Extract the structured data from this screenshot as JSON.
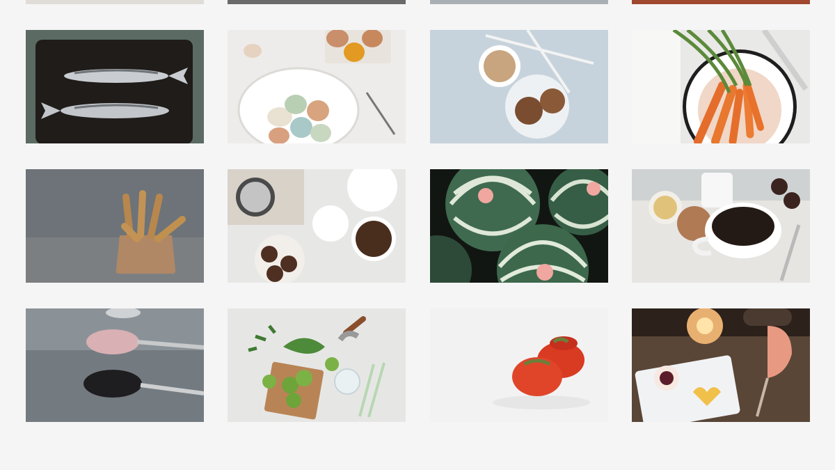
{
  "gallery": {
    "top_row": [
      {
        "subject": "partial-photo-1"
      },
      {
        "subject": "partial-photo-2"
      },
      {
        "subject": "partial-photo-3"
      },
      {
        "subject": "partial-photo-4"
      }
    ],
    "photos": [
      {
        "subject": "mackerel-on-baking-tray"
      },
      {
        "subject": "eggs-in-white-bowl"
      },
      {
        "subject": "coffee-and-cookies"
      },
      {
        "subject": "carrots-on-plate"
      },
      {
        "subject": "breadsticks-in-paper-bag"
      },
      {
        "subject": "coffee-beans-and-french-press"
      },
      {
        "subject": "kabocha-squash"
      },
      {
        "subject": "cup-of-coffee"
      },
      {
        "subject": "spoons-with-salt-and-seeds"
      },
      {
        "subject": "limes-and-herbs"
      },
      {
        "subject": "tomatoes-on-white"
      },
      {
        "subject": "candlelit-dessert-and-wine"
      }
    ]
  }
}
